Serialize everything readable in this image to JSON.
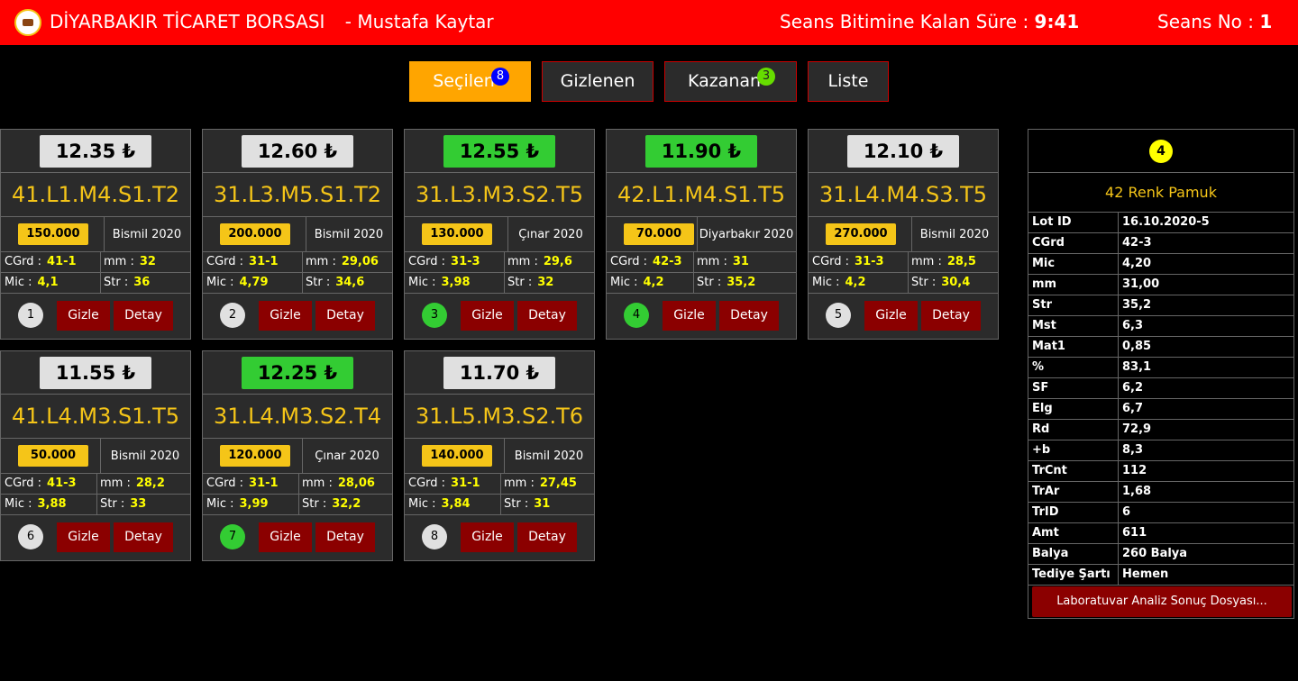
{
  "header": {
    "title": "DİYARBAKIR TİCARET BORSASI",
    "user": "- Mustafa Kaytar",
    "timer_label": "Seans Bitimine Kalan Süre :",
    "timer_value": "9:41",
    "seans_label": "Seans No :",
    "seans_value": "1"
  },
  "tabs": [
    {
      "label": "Seçilen",
      "badge": "8"
    },
    {
      "label": "Gizlenen",
      "badge": ""
    },
    {
      "label": "Kazanan",
      "badge": "3"
    },
    {
      "label": "Liste",
      "badge": ""
    }
  ],
  "labels": {
    "cgrd": "CGrd :",
    "mm": "mm :",
    "mic": "Mic :",
    "str": "Str :",
    "gizle": "Gizle",
    "detay": "Detay"
  },
  "cards": [
    {
      "price": "12.35 ₺",
      "code": "41.L1.M4.S1.T2",
      "qty": "150.000",
      "origin": "Bismil 2020",
      "cgrd": "41-1",
      "mm": "32",
      "mic": "4,1",
      "str": "36",
      "num": "1"
    },
    {
      "price": "12.60 ₺",
      "code": "31.L3.M5.S1.T2",
      "qty": "200.000",
      "origin": "Bismil 2020",
      "cgrd": "31-1",
      "mm": "29,06",
      "mic": "4,79",
      "str": "34,6",
      "num": "2"
    },
    {
      "price": "12.55 ₺",
      "code": "31.L3.M3.S2.T5",
      "qty": "130.000",
      "origin": "Çınar 2020",
      "cgrd": "31-3",
      "mm": "29,6",
      "mic": "3,98",
      "str": "32",
      "num": "3"
    },
    {
      "price": "11.90 ₺",
      "code": "42.L1.M4.S1.T5",
      "qty": "70.000",
      "origin": "Diyarbakır 2020",
      "cgrd": "42-3",
      "mm": "31",
      "mic": "4,2",
      "str": "35,2",
      "num": "4"
    },
    {
      "price": "12.10 ₺",
      "code": "31.L4.M4.S3.T5",
      "qty": "270.000",
      "origin": "Bismil 2020",
      "cgrd": "31-3",
      "mm": "28,5",
      "mic": "4,2",
      "str": "30,4",
      "num": "5"
    },
    {
      "price": "11.55 ₺",
      "code": "41.L4.M3.S1.T5",
      "qty": "50.000",
      "origin": "Bismil 2020",
      "cgrd": "41-3",
      "mm": "28,2",
      "mic": "3,88",
      "str": "33",
      "num": "6"
    },
    {
      "price": "12.25 ₺",
      "code": "31.L4.M3.S2.T4",
      "qty": "120.000",
      "origin": "Çınar 2020",
      "cgrd": "31-1",
      "mm": "28,06",
      "mic": "3,99",
      "str": "32,2",
      "num": "7"
    },
    {
      "price": "11.70 ₺",
      "code": "31.L5.M3.S2.T6",
      "qty": "140.000",
      "origin": "Bismil 2020",
      "cgrd": "31-1",
      "mm": "27,45",
      "mic": "3,84",
      "str": "31",
      "num": "8"
    }
  ],
  "panel": {
    "num": "4",
    "title": "42 Renk Pamuk",
    "rows": [
      {
        "k": "Lot ID",
        "v": "16.10.2020-5"
      },
      {
        "k": "CGrd",
        "v": "42-3"
      },
      {
        "k": "Mic",
        "v": "4,20"
      },
      {
        "k": "mm",
        "v": "31,00"
      },
      {
        "k": "Str",
        "v": "35,2"
      },
      {
        "k": "Mst",
        "v": "6,3"
      },
      {
        "k": "Mat1",
        "v": "0,85"
      },
      {
        "k": "%",
        "v": "83,1"
      },
      {
        "k": "SF",
        "v": "6,2"
      },
      {
        "k": "Elg",
        "v": "6,7"
      },
      {
        "k": "Rd",
        "v": "72,9"
      },
      {
        "k": "+b",
        "v": "8,3"
      },
      {
        "k": "TrCnt",
        "v": "112"
      },
      {
        "k": "TrAr",
        "v": "1,68"
      },
      {
        "k": "TrID",
        "v": "6"
      },
      {
        "k": "Amt",
        "v": "611"
      },
      {
        "k": "Balya",
        "v": "260 Balya"
      },
      {
        "k": "Tediye Şartı",
        "v": "Hemen"
      }
    ],
    "button": "Laboratuvar Analiz Sonuç Dosyası..."
  },
  "colors": {
    "header": "#ff0000",
    "accent": "#ffa500",
    "highlight": "#33cc33",
    "button": "#8b0000"
  }
}
